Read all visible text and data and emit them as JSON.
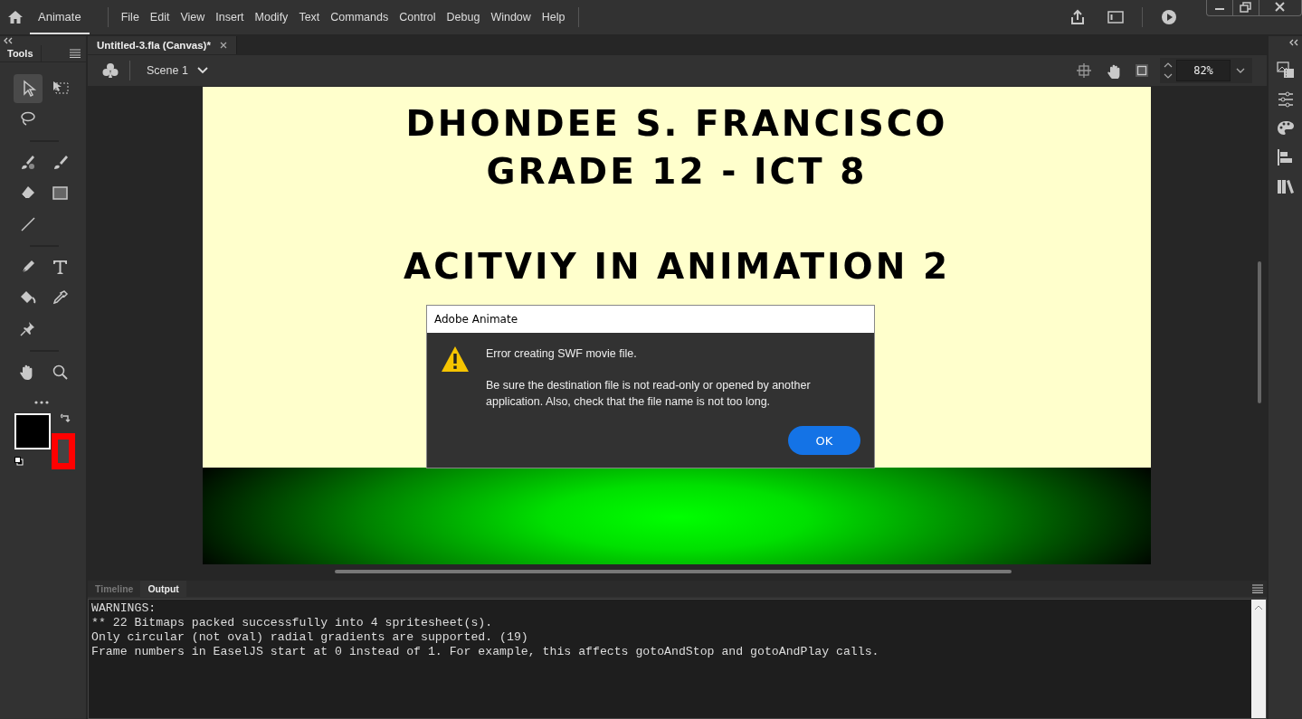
{
  "app": {
    "name": "Animate"
  },
  "menu": [
    "File",
    "Edit",
    "View",
    "Insert",
    "Modify",
    "Text",
    "Commands",
    "Control",
    "Debug",
    "Window",
    "Help"
  ],
  "tools_panel": {
    "title": "Tools",
    "groups": [
      [
        {
          "kind": "selection",
          "selected": true
        },
        {
          "kind": "free-transform",
          "selected": false
        },
        {
          "kind": "lasso",
          "selected": false
        }
      ],
      [
        {
          "kind": "paint-brush",
          "selected": false
        },
        {
          "kind": "brush",
          "selected": false
        },
        {
          "kind": "eraser",
          "selected": false
        },
        {
          "kind": "rectangle",
          "selected": false
        },
        {
          "kind": "line",
          "selected": false
        }
      ],
      [
        {
          "kind": "pen",
          "selected": false
        },
        {
          "kind": "text",
          "selected": false
        },
        {
          "kind": "bucket",
          "selected": false
        },
        {
          "kind": "eyedropper",
          "selected": false
        },
        {
          "kind": "pin",
          "selected": false
        }
      ],
      [
        {
          "kind": "hand",
          "selected": false
        },
        {
          "kind": "zoom",
          "selected": false
        }
      ]
    ]
  },
  "document_tab": {
    "title": "Untitled-3.fla (Canvas)*"
  },
  "scene": {
    "label": "Scene 1"
  },
  "zoom": {
    "value": "82%"
  },
  "stage": {
    "heading_lines": [
      "DHONDEE S. FRANCISCO",
      "GRADE 12 - ICT 8"
    ],
    "subtitle": "ACITVIY IN ANIMATION 2"
  },
  "dialog": {
    "title": "Adobe Animate",
    "message": "Error creating SWF movie file.",
    "detail": "Be sure the destination file is not read-only or opened by another application. Also, check that the file name is not too long.",
    "button": "OK"
  },
  "bottom_panel": {
    "tabs": [
      {
        "label": "Timeline",
        "selected": false
      },
      {
        "label": "Output",
        "selected": true
      }
    ],
    "output_lines": [
      "WARNINGS:",
      "** 22 Bitmaps packed successfully into 4 spritesheet(s).",
      "Only circular (not oval) radial gradients are supported. (19)",
      "Frame numbers in EaselJS start at 0 instead of 1. For example, this affects gotoAndStop and gotoAndPlay calls."
    ]
  }
}
